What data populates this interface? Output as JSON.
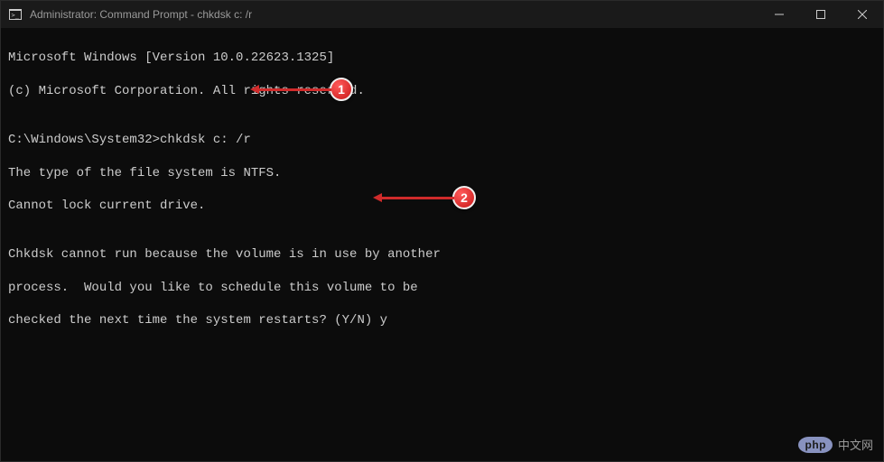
{
  "titlebar": {
    "title": "Administrator: Command Prompt - chkdsk  c: /r"
  },
  "terminal": {
    "line1": "Microsoft Windows [Version 10.0.22623.1325]",
    "line2": "(c) Microsoft Corporation. All rights reserved.",
    "line3": "",
    "line4": "C:\\Windows\\System32>chkdsk c: /r",
    "line5": "The type of the file system is NTFS.",
    "line6": "Cannot lock current drive.",
    "line7": "",
    "line8": "Chkdsk cannot run because the volume is in use by another",
    "line9": "process.  Would you like to schedule this volume to be",
    "line10": "checked the next time the system restarts? (Y/N) y"
  },
  "annotations": {
    "badge1": "1",
    "badge2": "2"
  },
  "watermark": {
    "logo": "php",
    "text": "中文网"
  }
}
